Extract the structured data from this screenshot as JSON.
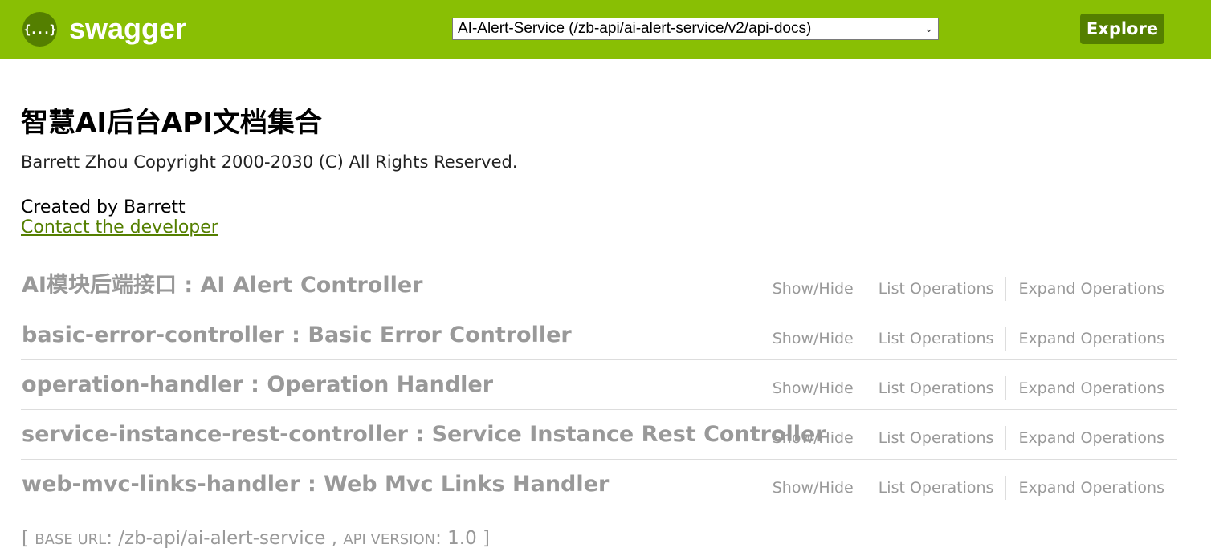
{
  "header": {
    "logo_icon": "{...}",
    "logo_text": "swagger",
    "api_select_value": "AI-Alert-Service (/zb-api/ai-alert-service/v2/api-docs)",
    "select_chevron": "⌄",
    "explore_label": "Explore",
    "brand_color": "#89bf04",
    "dark_color": "#547f00"
  },
  "info": {
    "title": "智慧AI后台API文档集合",
    "description": "Barrett Zhou Copyright 2000-2030 (C) All Rights Reserved.",
    "created_by": "Created by Barrett",
    "contact_link": "Contact the developer"
  },
  "resource_actions": {
    "show_hide": "Show/Hide",
    "list_operations": "List Operations",
    "expand_operations": "Expand Operations"
  },
  "resources": [
    {
      "heading": "AI模块后端接口 : AI Alert Controller"
    },
    {
      "heading": "basic-error-controller : Basic Error Controller"
    },
    {
      "heading": "operation-handler : Operation Handler"
    },
    {
      "heading": "service-instance-rest-controller : Service Instance Rest Controller"
    },
    {
      "heading": "web-mvc-links-handler : Web Mvc Links Handler"
    }
  ],
  "footer": {
    "open_bracket": "[ ",
    "base_url_label": "BASE URL",
    "base_url_value": ": /zb-api/ai-alert-service , ",
    "api_version_label": "API VERSION",
    "api_version_value": ": 1.0 ]"
  }
}
